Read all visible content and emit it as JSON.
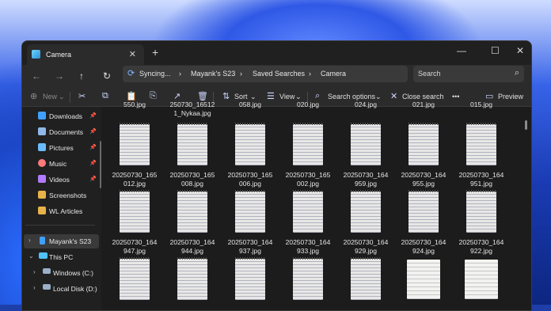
{
  "window": {
    "tab_title": "Camera",
    "tab_close": "✕",
    "new_tab": "+",
    "minimize": "—",
    "maximize": "☐",
    "close": "✕"
  },
  "nav": {
    "back": "←",
    "forward": "→",
    "up": "↑",
    "refresh": "↻",
    "syncing": "Syncing...",
    "breadcrumb": [
      "Mayank's S23",
      "Saved Searches",
      "Camera"
    ],
    "sep": "›",
    "search_placeholder": "Search"
  },
  "toolbar": {
    "new_label": "New",
    "sort_label": "Sort",
    "view_label": "View",
    "search_options_label": "Search options",
    "close_search_label": "Close search",
    "more_label": "•••",
    "preview_label": "Preview"
  },
  "sidebar": {
    "quick": [
      {
        "label": "Downloads",
        "color": "#3fa0ff",
        "pinned": true
      },
      {
        "label": "Documents",
        "color": "#8fb7e8",
        "pinned": true
      },
      {
        "label": "Pictures",
        "color": "#6bbcff",
        "pinned": true
      },
      {
        "label": "Music",
        "color": "#ff7a7a",
        "pinned": true
      },
      {
        "label": "Videos",
        "color": "#b07bff",
        "pinned": true
      },
      {
        "label": "Screenshots",
        "color": "#e8b24a",
        "pinned": false
      },
      {
        "label": "WL Articles",
        "color": "#e8b24a",
        "pinned": false
      }
    ],
    "devices": [
      {
        "label": "Mayank's S23",
        "expanded": false,
        "selected": true
      },
      {
        "label": "This PC",
        "expanded": true,
        "selected": false
      },
      {
        "label": "Windows (C:)",
        "expanded": false,
        "selected": false
      },
      {
        "label": "Local Disk (D:)",
        "expanded": false,
        "selected": false
      }
    ]
  },
  "files": {
    "top_partial": [
      "550.jpg",
      "250730_16512\n1_Nykaa.jpg",
      "058.jpg",
      "020.jpg",
      "024.jpg",
      "021.jpg",
      "015.jpg"
    ],
    "row1": [
      "20250730_165\n012.jpg",
      "20250730_165\n008.jpg",
      "20250730_165\n006.jpg",
      "20250730_165\n002.jpg",
      "20250730_164\n959.jpg",
      "20250730_164\n955.jpg",
      "20250730_164\n951.jpg"
    ],
    "row2": [
      "20250730_164\n947.jpg",
      "20250730_164\n944.jpg",
      "20250730_164\n937.jpg",
      "20250730_164\n933.jpg",
      "20250730_164\n929.jpg",
      "20250730_164\n924.jpg",
      "20250730_164\n922.jpg"
    ]
  },
  "colors": {
    "accent": "#4c9bff",
    "window_bg": "#1c1c1c",
    "bar_bg": "#2b2b2b"
  }
}
